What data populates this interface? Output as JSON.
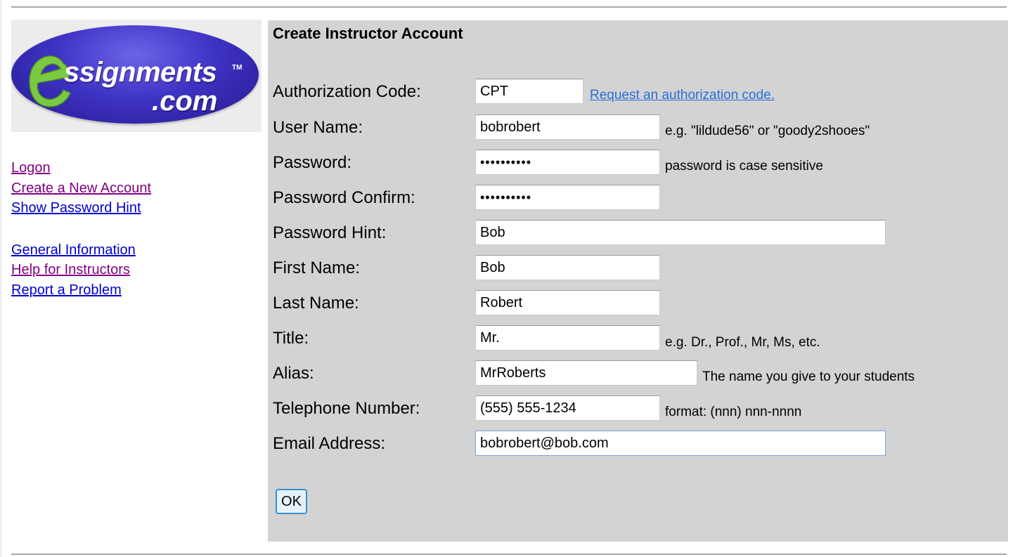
{
  "logo": {
    "wordmark": "ssignments",
    "tm": "TM",
    "dotcom": ".com"
  },
  "nav": {
    "logon": "Logon",
    "create_account": "Create a New Account",
    "show_hint": "Show Password Hint",
    "general_info": "General Information",
    "help_instructors": "Help for Instructors",
    "report_problem": "Report a Problem"
  },
  "form": {
    "title": "Create Instructor Account",
    "auth_code": {
      "label": "Authorization Code:",
      "value": "CPT",
      "link": "Request an authorization code."
    },
    "user_name": {
      "label": "User Name:",
      "value": "bobrobert",
      "hint": "e.g. \"lildude56\" or \"goody2shooes\""
    },
    "password": {
      "label": "Password:",
      "value": "••••••••••",
      "hint": "password is case sensitive"
    },
    "password_confirm": {
      "label": "Password Confirm:",
      "value": "••••••••••"
    },
    "password_hint": {
      "label": "Password Hint:",
      "value": "Bob"
    },
    "first_name": {
      "label": "First Name:",
      "value": "Bob"
    },
    "last_name": {
      "label": "Last Name:",
      "value": "Robert"
    },
    "title_field": {
      "label": "Title:",
      "value": "Mr.",
      "hint": "e.g. Dr., Prof., Mr, Ms, etc."
    },
    "alias": {
      "label": "Alias:",
      "value": "MrRoberts",
      "hint": "The name you give to your students"
    },
    "telephone": {
      "label": "Telephone Number:",
      "value": "(555) 555-1234",
      "hint": "format: (nnn) nnn-nnnn"
    },
    "email": {
      "label": "Email Address:",
      "value": "bobrobert@bob.com"
    },
    "ok_label": "OK"
  },
  "colors": {
    "panel_bg": "#d3d3d3",
    "link_visited": "#800080",
    "link_unvisited": "#0000cc",
    "logo_blue": "#3f33c5",
    "logo_green": "#7ac943"
  }
}
